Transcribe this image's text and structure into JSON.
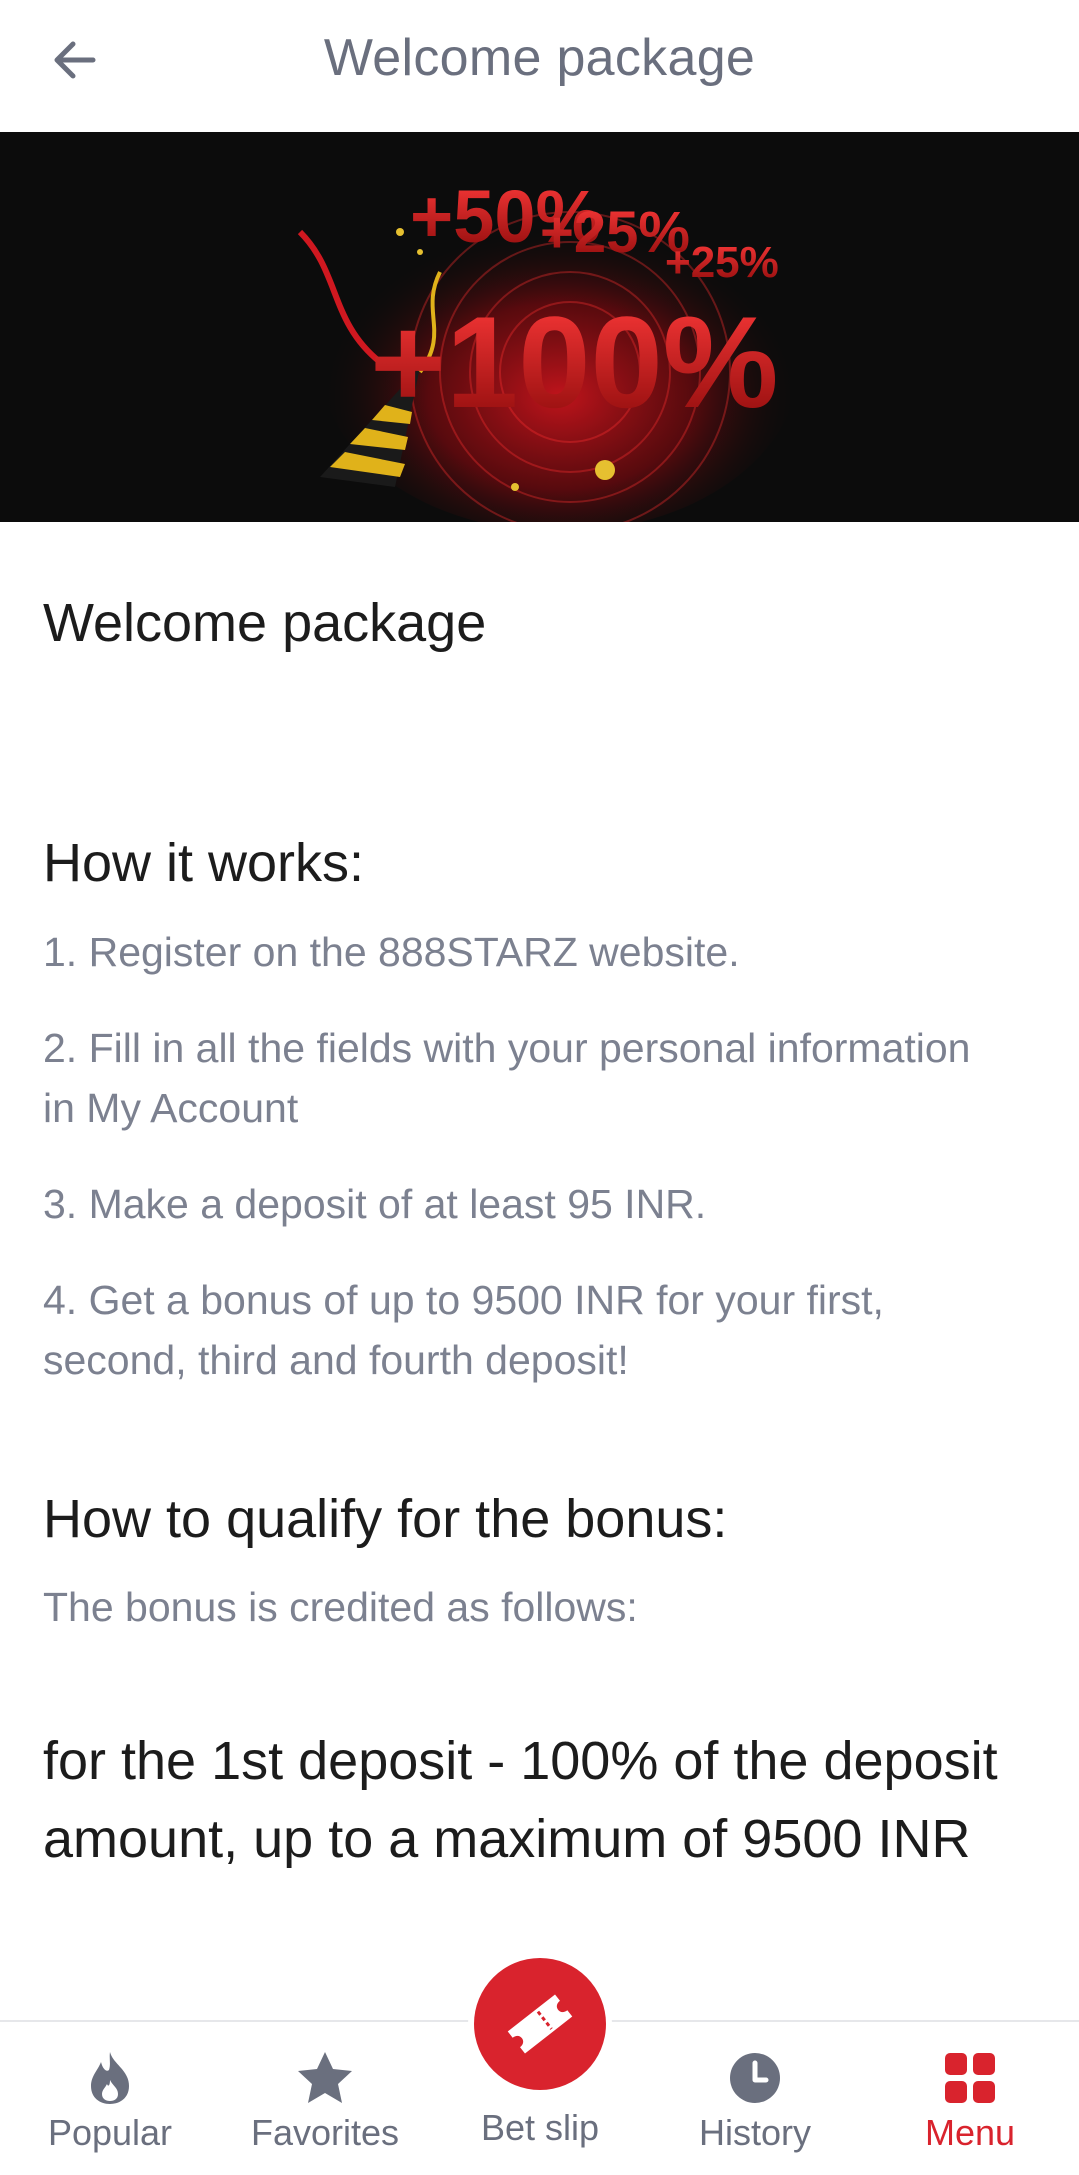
{
  "header": {
    "title": "Welcome package"
  },
  "banner": {
    "texts": [
      "+50%",
      "+25%",
      "+25%",
      "+100%"
    ]
  },
  "promo": {
    "title": "Welcome package"
  },
  "how_it_works": {
    "heading": "How it works:",
    "steps": [
      "1. Register on the 888STARZ website.",
      "2. Fill in all the fields with your personal information in My Account",
      "3. Make a deposit of at least 95 INR.",
      "4. Get a bonus of up to 9500 INR for your first, second, third and fourth deposit!"
    ]
  },
  "qualify": {
    "heading": "How to qualify for the bonus:",
    "note": "The bonus is credited as follows:",
    "first_deposit": "for the 1st deposit - 100% of the deposit amount, up to a maximum of 9500 INR"
  },
  "bottom_nav": {
    "items": [
      {
        "label": "Popular",
        "icon": "flame-icon"
      },
      {
        "label": "Favorites",
        "icon": "star-icon"
      },
      {
        "label": "Bet slip",
        "icon": "ticket-icon"
      },
      {
        "label": "History",
        "icon": "clock-icon"
      },
      {
        "label": "Menu",
        "icon": "grid-icon"
      }
    ],
    "active": "Menu"
  },
  "colors": {
    "accent": "#d9232d",
    "header_text": "#6a6f7e",
    "body_text": "#7c8190",
    "heading_text": "#1c1c1c",
    "banner_bg": "#0c0c0c"
  }
}
